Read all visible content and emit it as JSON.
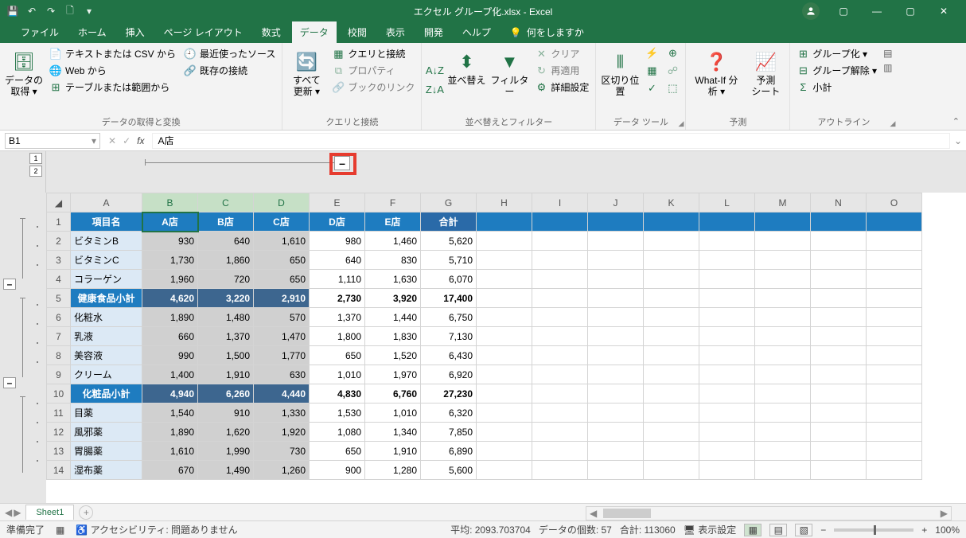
{
  "title": "エクセル グループ化.xlsx - Excel",
  "qa": {
    "save": "💾",
    "undo": "↶",
    "redo": "↷",
    "newfile": "🗋"
  },
  "win": {
    "min": "—",
    "max": "▢",
    "close": "✕",
    "ribmin": "▢"
  },
  "tabs": [
    "ファイル",
    "ホーム",
    "挿入",
    "ページ レイアウト",
    "数式",
    "データ",
    "校閲",
    "表示",
    "開発",
    "ヘルプ"
  ],
  "active_tab": 5,
  "tell_label": "何をしますか",
  "ribbon": {
    "g1": {
      "label": "データの取得と変換",
      "getdata": "データの\n取得 ▾",
      "csv": "テキストまたは CSV から",
      "web": "Web から",
      "table": "テーブルまたは範囲から",
      "recent": "最近使ったソース",
      "existing": "既存の接続"
    },
    "g2": {
      "label": "クエリと接続",
      "refresh": "すべて\n更新 ▾",
      "conn": "クエリと接続",
      "prop": "プロパティ",
      "link": "ブックのリンク"
    },
    "g3": {
      "label": "並べ替えとフィルター",
      "az": "A↓Z",
      "za": "Z↓A",
      "sort": "並べ替え",
      "filter": "フィルター",
      "clear": "クリア",
      "reapply": "再適用",
      "adv": "詳細設定"
    },
    "g4": {
      "label": "データ ツール",
      "split": "区切り位置"
    },
    "g5": {
      "label": "予測",
      "whatif": "What-If 分析 ▾",
      "forecast": "予測\nシート"
    },
    "g6": {
      "label": "アウトライン",
      "group": "グループ化 ▾",
      "ungroup": "グループ解除 ▾",
      "subtotal": "小計"
    }
  },
  "namebox": "B1",
  "formula": "A店",
  "levels": [
    "1",
    "2"
  ],
  "collapse": "–",
  "col_headers": [
    "A",
    "B",
    "C",
    "D",
    "E",
    "F",
    "G",
    "H",
    "I",
    "J",
    "K",
    "L",
    "M",
    "N",
    "O"
  ],
  "row_nums": [
    1,
    2,
    3,
    4,
    5,
    6,
    7,
    8,
    9,
    10,
    11,
    12,
    13,
    14
  ],
  "data": {
    "headers": [
      "項目名",
      "A店",
      "B店",
      "C店",
      "D店",
      "E店",
      "合計"
    ],
    "rows": [
      {
        "lab": "ビタミンB",
        "v": [
          930,
          640,
          1610,
          980,
          1460,
          5620
        ]
      },
      {
        "lab": "ビタミンC",
        "v": [
          1730,
          1860,
          650,
          640,
          830,
          5710
        ]
      },
      {
        "lab": "コラーゲン",
        "v": [
          1960,
          720,
          650,
          1110,
          1630,
          6070
        ]
      },
      {
        "lab": "健康食品小計",
        "v": [
          4620,
          3220,
          2910,
          2730,
          3920,
          17400
        ],
        "sub": true
      },
      {
        "lab": "化粧水",
        "v": [
          1890,
          1480,
          570,
          1370,
          1440,
          6750
        ]
      },
      {
        "lab": "乳液",
        "v": [
          660,
          1370,
          1470,
          1800,
          1830,
          7130
        ]
      },
      {
        "lab": "美容液",
        "v": [
          990,
          1500,
          1770,
          650,
          1520,
          6430
        ]
      },
      {
        "lab": "クリーム",
        "v": [
          1400,
          1910,
          630,
          1010,
          1970,
          6920
        ]
      },
      {
        "lab": "化粧品小計",
        "v": [
          4940,
          6260,
          4440,
          4830,
          6760,
          27230
        ],
        "sub": true
      },
      {
        "lab": "目薬",
        "v": [
          1540,
          910,
          1330,
          1530,
          1010,
          6320
        ]
      },
      {
        "lab": "風邪薬",
        "v": [
          1890,
          1620,
          1920,
          1080,
          1340,
          7850
        ]
      },
      {
        "lab": "胃腸薬",
        "v": [
          1610,
          1990,
          730,
          650,
          1910,
          6890
        ]
      },
      {
        "lab": "湿布薬",
        "v": [
          670,
          1490,
          1260,
          900,
          1280,
          5600
        ]
      }
    ]
  },
  "sheet_tab": "Sheet1",
  "status": {
    "ready": "準備完了",
    "acc": "アクセシビリティ: 問題ありません",
    "avg": "平均: 2093.703704",
    "count": "データの個数: 57",
    "sum": "合計: 113060",
    "display": "表示設定",
    "zoom": "100%"
  }
}
